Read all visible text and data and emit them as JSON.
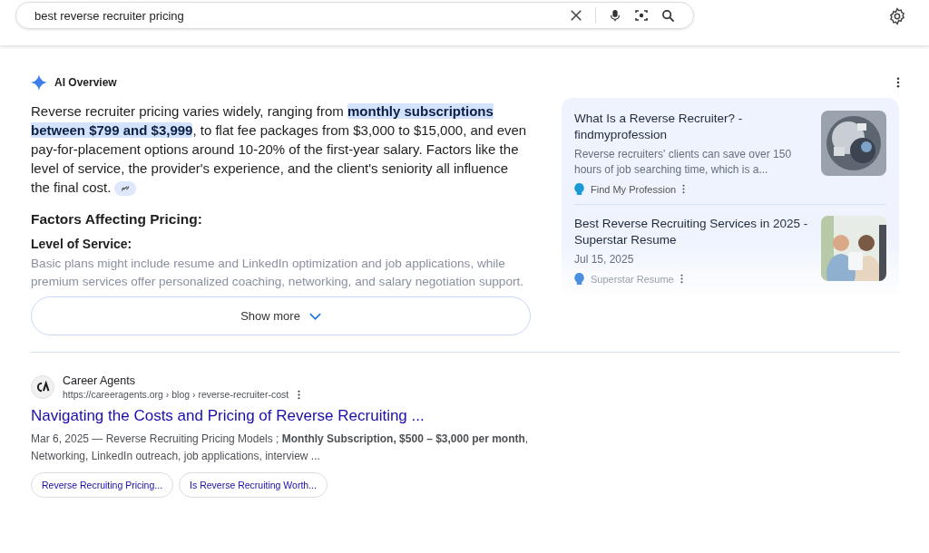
{
  "search": {
    "value": "best reverse recruiter pricing"
  },
  "ai_overview": {
    "title": "AI Overview",
    "summary": [
      {
        "text": "Reverse recruiter pricing varies widely, ranging from ",
        "highlight": false
      },
      {
        "text": "monthly subscriptions between $799 and $3,999",
        "highlight": true
      },
      {
        "text": ", to flat fee packages from $3,000 to $15,000, and even pay-for-placement options around 10-20% of the first-year salary. Factors like the level of service, the provider's experience, and the client's seniority all influence the final cost.",
        "highlight": false
      }
    ],
    "heading": "Factors Affecting Pricing:",
    "subheading": "Level of Service:",
    "detail": "Basic plans might include resume and LinkedIn optimization and job applications, while premium services offer personalized coaching, networking, and salary negotiation support.",
    "show_more": "Show more",
    "sources": [
      {
        "title": "What Is a Reverse Recruiter? - findmyprofession",
        "snippet": "Reverse recruiters' clients can save over 150 hours of job searching time, which is a...",
        "site": "Find My Profession",
        "color": "#1a9ad6"
      },
      {
        "title": "Best Reverse Recruiting Services in 2025 - Superstar Resume",
        "snippet": "Jul 15, 2025",
        "site": "Superstar Resume",
        "color": "#4a8fe0"
      }
    ]
  },
  "results": [
    {
      "site": "Career Agents",
      "url": "https://careeragents.org › blog › reverse-recruiter-cost",
      "title": "Navigating the Costs and Pricing of Reverse Recruiting ...",
      "snippet": "Mar 6, 2025 — Reverse Recruiting Pricing Models ; **Monthly Subscription, $500 – $3,000 per month**, Networking, LinkedIn outreach, job applications, interview ...",
      "links": [
        "Reverse Recruiting Pricing...",
        "Is Reverse Recruiting Worth..."
      ]
    }
  ]
}
